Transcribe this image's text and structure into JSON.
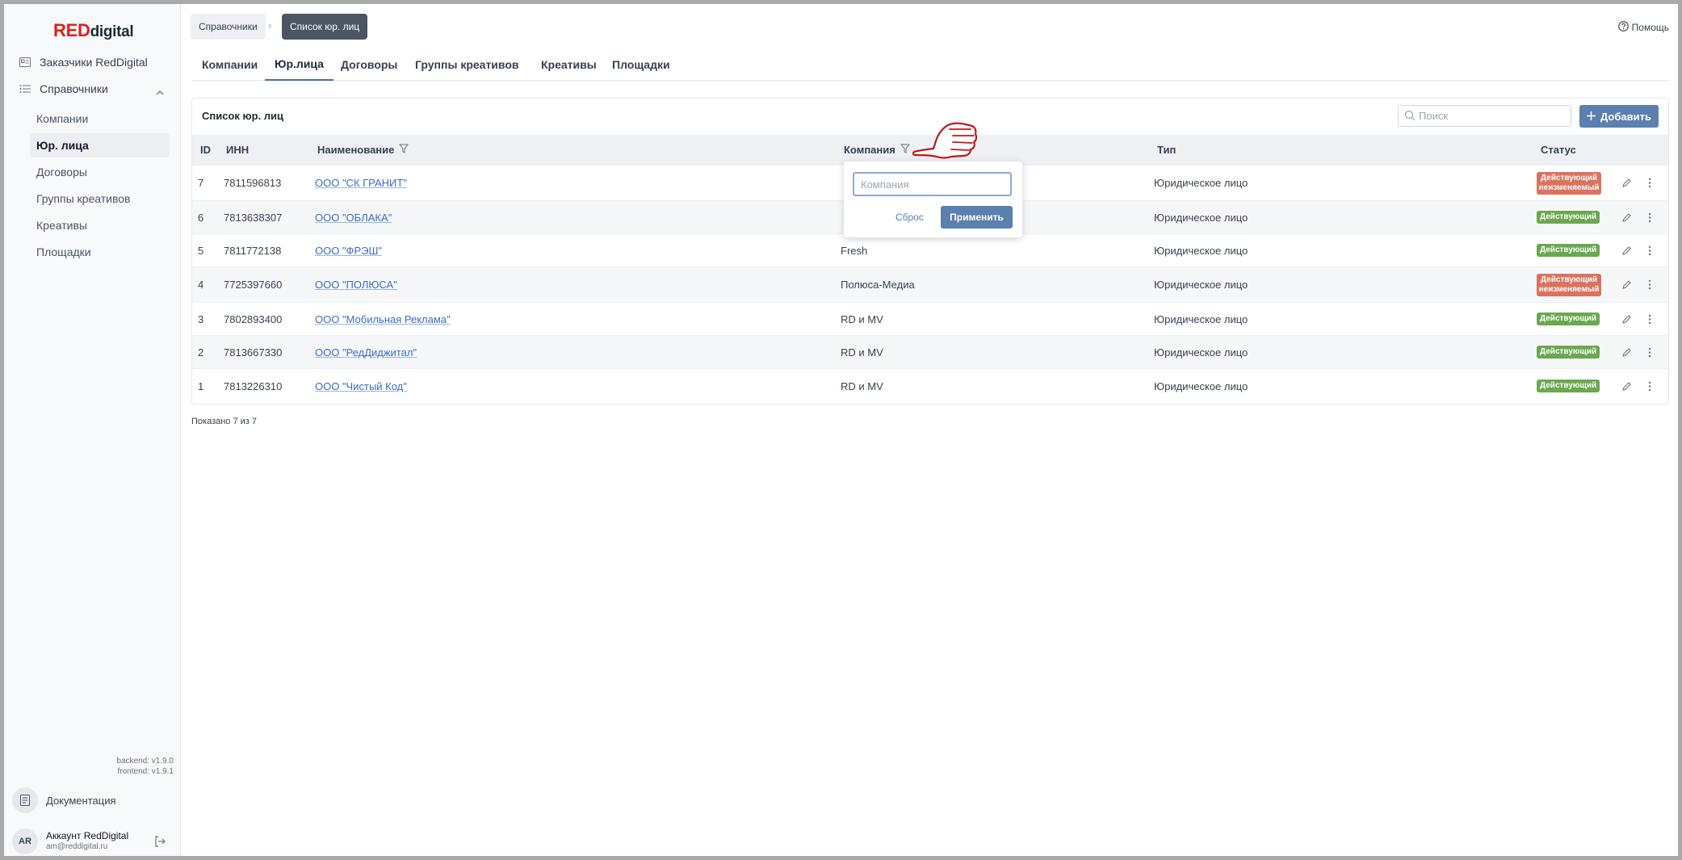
{
  "logo": {
    "red": "RED",
    "rest": "digital"
  },
  "sidebar": {
    "customers": "Заказчики RedDigital",
    "directories": "Справочники",
    "sub_items": [
      {
        "label": "Компании",
        "active": false
      },
      {
        "label": "Юр. лица",
        "active": true
      },
      {
        "label": "Договоры",
        "active": false
      },
      {
        "label": "Группы креативов",
        "active": false
      },
      {
        "label": "Креативы",
        "active": false
      },
      {
        "label": "Площадки",
        "active": false
      }
    ],
    "versions": {
      "backend": "backend: v1.9.0",
      "frontend": "frontend: v1.9.1"
    },
    "documentation": "Документация",
    "account": {
      "initials": "AR",
      "name": "Аккаунт RedDigital",
      "email": "am@reddigital.ru"
    }
  },
  "breadcrumbs": [
    "Справочники",
    "Список юр. лиц"
  ],
  "help": "Помощь",
  "tabs": [
    {
      "label": "Компании",
      "active": false
    },
    {
      "label": "Юр.лица",
      "active": true
    },
    {
      "label": "Договоры",
      "active": false
    },
    {
      "label": "Группы креативов",
      "active": false
    },
    {
      "label": "Креативы",
      "active": false
    },
    {
      "label": "Площадки",
      "active": false
    }
  ],
  "card": {
    "title": "Список юр. лиц",
    "search_placeholder": "Поиск",
    "add_label": "Добавить",
    "columns": {
      "id": "ID",
      "inn": "ИНН",
      "name": "Наименование",
      "company": "Компания",
      "type": "Тип",
      "status": "Статус"
    },
    "rows": [
      {
        "id": "7",
        "inn": "7811596813",
        "name": "ООО \"СК ГРАНИТ\"",
        "company": "",
        "type": "Юридическое лицо",
        "status": "Действующий неизменяемый",
        "status_color": "#d9735f"
      },
      {
        "id": "6",
        "inn": "7813638307",
        "name": "ООО \"ОБЛАКА\"",
        "company": "",
        "type": "Юридическое лицо",
        "status": "Действующий",
        "status_color": "#6aa84f"
      },
      {
        "id": "5",
        "inn": "7811772138",
        "name": "ООО \"ФРЭШ\"",
        "company": "Fresh",
        "type": "Юридическое лицо",
        "status": "Действующий",
        "status_color": "#6aa84f"
      },
      {
        "id": "4",
        "inn": "7725397660",
        "name": "ООО \"ПОЛЮСА\"",
        "company": "Полюса-Медиа",
        "type": "Юридическое лицо",
        "status": "Действующий неизменяемый",
        "status_color": "#d9735f"
      },
      {
        "id": "3",
        "inn": "7802893400",
        "name": "ООО \"Мобильная Реклама\"",
        "company": "RD и MV",
        "type": "Юридическое лицо",
        "status": "Действующий",
        "status_color": "#6aa84f"
      },
      {
        "id": "2",
        "inn": "7813667330",
        "name": "ООО \"РедДиджитал\"",
        "company": "RD и MV",
        "type": "Юридическое лицо",
        "status": "Действующий",
        "status_color": "#6aa84f"
      },
      {
        "id": "1",
        "inn": "7813226310",
        "name": "ООО \"Чистый Код\"",
        "company": "RD и MV",
        "type": "Юридическое лицо",
        "status": "Действующий",
        "status_color": "#6aa84f"
      }
    ],
    "shown": "Показано 7 из 7"
  },
  "popover": {
    "placeholder": "Компания",
    "reset": "Сброс",
    "apply": "Применить"
  },
  "colors": {
    "accent": "#5b7fae",
    "brand_red": "#e11d1d",
    "status_green": "#6aa84f",
    "status_red": "#d9735f"
  }
}
